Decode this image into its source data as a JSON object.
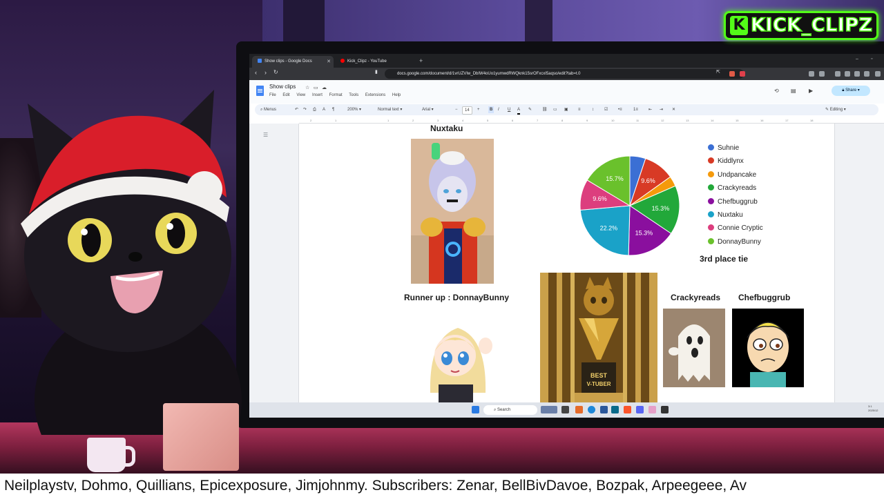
{
  "logo": {
    "text": "KICK_CLIPZ",
    "letter": "K",
    "color": "#53fc18"
  },
  "browser": {
    "tabs": [
      {
        "label": "Show clips - Google Docs",
        "icon": "google-docs-icon",
        "active": true
      },
      {
        "label": "Kick_Clipz - YouTube",
        "icon": "youtube-icon",
        "active": false
      }
    ],
    "url": "docs.google.com/document/d/1vrUZVIw_DbIW4oUo1yumwdRWQknk15srOFxcxI5aqso/edit?tab=t.0"
  },
  "docs": {
    "title": "Show clips",
    "menu": [
      "File",
      "Edit",
      "View",
      "Insert",
      "Format",
      "Tools",
      "Extensions",
      "Help"
    ],
    "share_label": "Share",
    "toolbar": {
      "search": "Menus",
      "zoom": "200%",
      "style": "Normal text",
      "font": "Arial",
      "font_size": "14",
      "mode": "Editing"
    },
    "ruler_ticks": [
      "2",
      "1",
      "1",
      "2",
      "3",
      "4",
      "5",
      "6",
      "7",
      "8",
      "9",
      "10",
      "11",
      "12",
      "13",
      "14",
      "15",
      "16",
      "17",
      "18"
    ]
  },
  "content": {
    "heading_top": "Nuxtaku",
    "runner_up": "Runner up : DonnayBunny",
    "third_place": "3rd place tie",
    "third_names": [
      "Crackyreads",
      "Chefbuggrub"
    ],
    "trophy_text": [
      "BEST",
      "V-TUBER"
    ]
  },
  "chart_data": {
    "type": "pie",
    "categories": [
      "Suhnie",
      "Kiddlynx",
      "Undpancake",
      "Crackyreads",
      "Chefbuggrub",
      "Nuxtaku",
      "Connie Cryptic",
      "DonnayBunny"
    ],
    "values": [
      4.9,
      9.6,
      3.2,
      15.3,
      15.3,
      22.2,
      9.6,
      15.7
    ],
    "labels": [
      "",
      "9.6%",
      "",
      "15.3%",
      "15.3%",
      "22.2%",
      "9.6%",
      "15.7%"
    ],
    "colors": [
      "#3b6fd4",
      "#d83a25",
      "#f59a0b",
      "#22a83a",
      "#8a0f9e",
      "#1aa2c8",
      "#dc3e7e",
      "#6ac12c"
    ],
    "legend_position": "right"
  },
  "taskbar": {
    "search": "Search",
    "clock": [
      "3:1",
      "2025/12"
    ]
  },
  "ticker": {
    "text": "Neilplaystv, Dohmo, Quillians, Epicexposure, Jimjohnmy.  Subscribers: Zenar, BellBivDavoe, Bozpak, Arpeegeee, Av"
  }
}
